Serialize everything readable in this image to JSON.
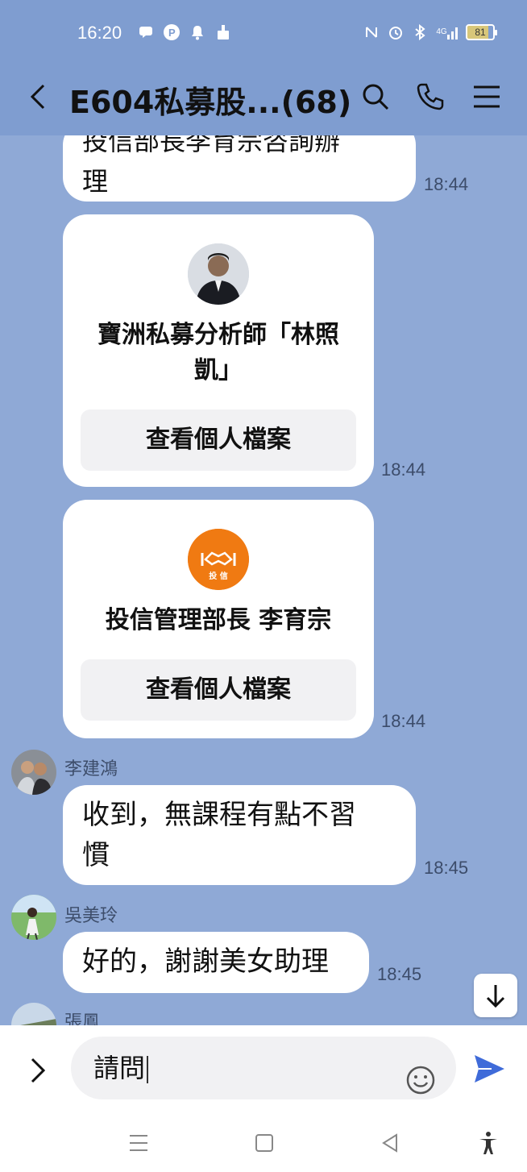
{
  "status_bar": {
    "time": "16:20",
    "network": "4G",
    "battery": "81"
  },
  "header": {
    "title": "E604私募股...(68)"
  },
  "messages": [
    {
      "type": "text",
      "text": "投信部長李育宗咨詢辦理",
      "time": "18:44"
    },
    {
      "type": "profile_card",
      "name": "寶洲私募分析師「林照凱」",
      "button": "查看個人檔案",
      "time": "18:44"
    },
    {
      "type": "profile_card",
      "name": "投信管理部長 李育宗",
      "logo_text": "投 信",
      "button": "查看個人檔案",
      "time": "18:44"
    },
    {
      "type": "text",
      "sender": "李建鴻",
      "text": "收到，無課程有點不習慣",
      "time": "18:45"
    },
    {
      "type": "text",
      "sender": "吳美玲",
      "text": "好的，謝謝美女助理",
      "time": "18:45"
    },
    {
      "type": "text",
      "sender": "張鳳"
    }
  ],
  "msg1_line1": "投信部長李育宗咨詢辦",
  "msg1_line2": "理",
  "card1_line1": "寶洲私募分析師「林照",
  "card1_line2": "凱」",
  "msg4_line1": "收到，無課程有點不習",
  "msg4_line2": "慣",
  "input": {
    "value": "請問"
  },
  "colors": {
    "chat_bg": "#8fa9d6",
    "send": "#3f6bd9",
    "logo_orange": "#f07a12"
  }
}
